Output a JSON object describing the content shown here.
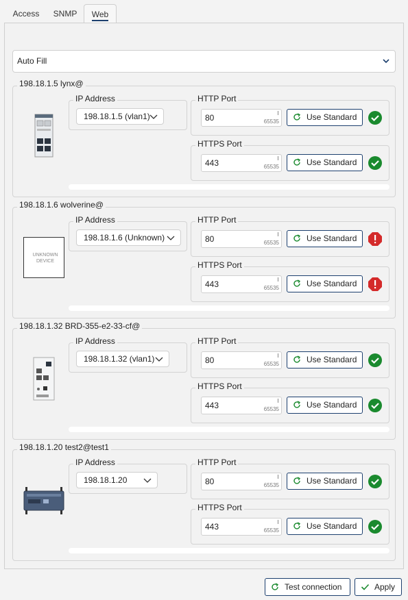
{
  "tabs": [
    {
      "label": "Access",
      "active": false
    },
    {
      "label": "SNMP",
      "active": false
    },
    {
      "label": "Web",
      "active": true
    }
  ],
  "autofill": {
    "selected": "Auto Fill"
  },
  "labels": {
    "ip_address": "IP Address",
    "http_port": "HTTP Port",
    "https_port": "HTTPS Port",
    "use_standard": "Use Standard",
    "port_max": "65535",
    "unknown_device": "UNKNOWN DEVICE"
  },
  "devices": [
    {
      "title": "198.18.1.5 lynx@",
      "ip": "198.18.1.5 (vlan1)",
      "http": "80",
      "https": "443",
      "http_status": "ok",
      "https_status": "ok",
      "image": "switch-device-icon"
    },
    {
      "title": "198.18.1.6 wolverine@",
      "ip": "198.18.1.6 (Unknown)",
      "http": "80",
      "https": "443",
      "http_status": "error",
      "https_status": "error",
      "image": "unknown-device-icon"
    },
    {
      "title": "198.18.1.32 BRD-355-e2-33-cf@",
      "ip": "198.18.1.32 (vlan1)",
      "http": "80",
      "https": "443",
      "http_status": "ok",
      "https_status": "ok",
      "image": "din-router-icon"
    },
    {
      "title": "198.18.1.20 test2@test1",
      "ip": "198.18.1.20",
      "http": "80",
      "https": "443",
      "http_status": "ok",
      "https_status": "ok",
      "image": "rugged-router-icon"
    }
  ],
  "footer": {
    "test_connection": "Test connection",
    "apply": "Apply"
  },
  "colors": {
    "accent": "#1c3f6e",
    "ok": "#1a8a2e",
    "error": "#d42a2a"
  }
}
